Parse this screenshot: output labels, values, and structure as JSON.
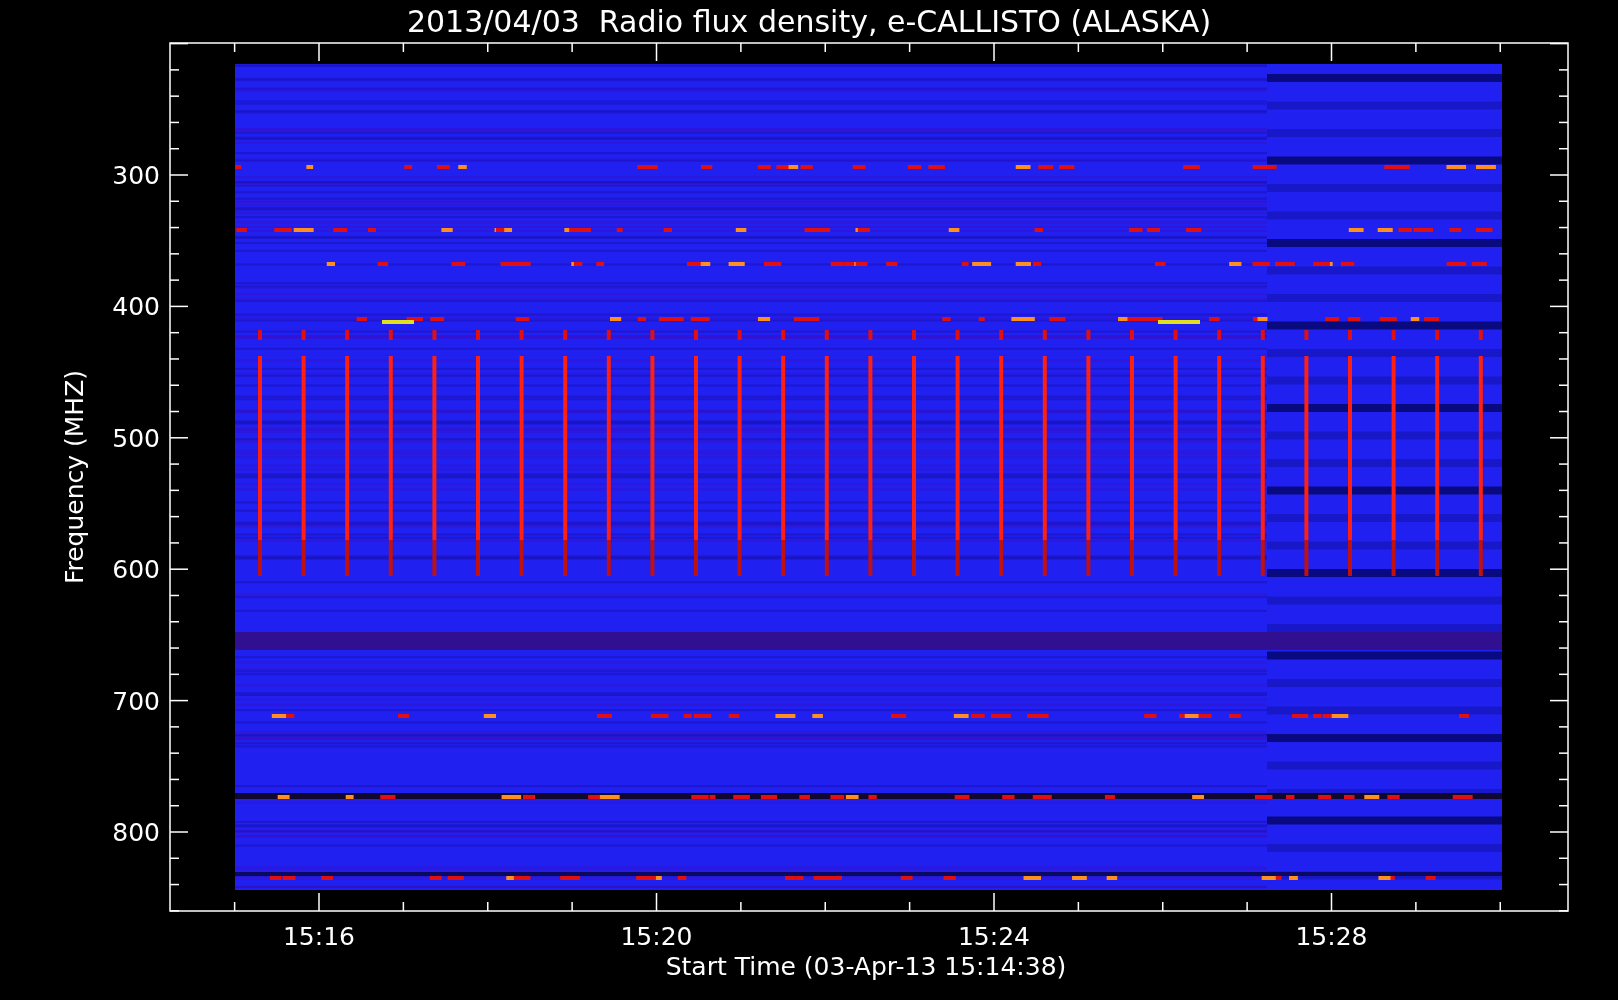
{
  "title": "2013/04/03  Radio flux density, e-CALLISTO (ALASKA)",
  "y_axis": {
    "label": "Frequency (MHZ)",
    "ticks": [
      "300",
      "400",
      "500",
      "600",
      "700",
      "800"
    ]
  },
  "x_axis": {
    "label": "Start Time (03-Apr-13 15:14:38)",
    "ticks": [
      "15:16",
      "15:20",
      "15:24",
      "15:28"
    ]
  }
}
